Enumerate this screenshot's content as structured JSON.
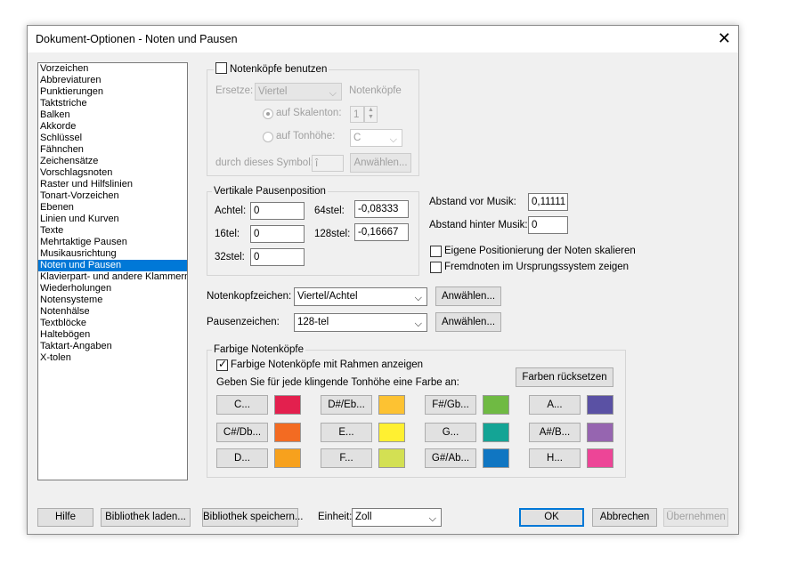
{
  "window": {
    "title": "Dokument-Optionen - Noten und Pausen"
  },
  "sidebar": {
    "items": [
      "Vorzeichen",
      "Abbreviaturen",
      "Punktierungen",
      "Taktstriche",
      "Balken",
      "Akkorde",
      "Schlüssel",
      "Fähnchen",
      "Zeichensätze",
      "Vorschlagsnoten",
      "Raster und Hilfslinien",
      "Tonart-Vorzeichen",
      "Ebenen",
      "Linien und Kurven",
      "Texte",
      "Mehrtaktige Pausen",
      "Musikausrichtung",
      "Noten und Pausen",
      "Klavierpart- und andere Klammern",
      "Wiederholungen",
      "Notensysteme",
      "Notenhälse",
      "Textblöcke",
      "Haltebögen",
      "Taktart-Angaben",
      "X-tolen"
    ],
    "selected": "Noten und Pausen"
  },
  "noteheads": {
    "checkbox_label": "Notenköpfe benutzen",
    "replace_label": "Ersetze:",
    "replace_value": "Viertel",
    "noteheads_label": "Notenköpfe",
    "on_scale_label": "auf Skalenton:",
    "scale_value": "1",
    "on_pitch_label": "auf Tonhöhe:",
    "pitch_value": "C",
    "symbol_label": "durch dieses Symbol:",
    "symbol_value": "î",
    "select_label": "Anwählen..."
  },
  "rest_position": {
    "legend": "Vertikale Pausenposition",
    "fields": [
      {
        "label": "Achtel:",
        "value": "0"
      },
      {
        "label": "16tel:",
        "value": "0"
      },
      {
        "label": "32stel:",
        "value": "0"
      },
      {
        "label": "64stel:",
        "value": "-0,08333"
      },
      {
        "label": "128stel:",
        "value": "-0,16667"
      }
    ]
  },
  "spacing": {
    "before_label": "Abstand vor Musik:",
    "before_value": "0,11111",
    "after_label": "Abstand hinter Musik:",
    "after_value": "0",
    "scale_label": "Eigene Positionierung der Noten skalieren",
    "cue_label": "Fremdnoten im Ursprungssystem zeigen"
  },
  "characters": {
    "notehead_label": "Notenkopfzeichen:",
    "notehead_value": "Viertel/Achtel",
    "rest_label": "Pausenzeichen:",
    "rest_value": "128-tel",
    "select_label": "Anwählen..."
  },
  "colored": {
    "legend": "Farbige Notenköpfe",
    "frame_label": "Farbige Notenköpfe mit Rahmen anzeigen",
    "reset_label": "Farben rücksetzen",
    "instruction": "Geben Sie für jede klingende Tonhöhe eine Farbe an:",
    "pitches": [
      {
        "label": "C...",
        "color": "#e3204e"
      },
      {
        "label": "C#/Db...",
        "color": "#f36b22"
      },
      {
        "label": "D...",
        "color": "#f7a11d"
      },
      {
        "label": "D#/Eb...",
        "color": "#fdc232"
      },
      {
        "label": "E...",
        "color": "#fff031"
      },
      {
        "label": "F...",
        "color": "#d3e053"
      },
      {
        "label": "F#/Gb...",
        "color": "#6fba43"
      },
      {
        "label": "G...",
        "color": "#14a495"
      },
      {
        "label": "G#/Ab...",
        "color": "#1076c2"
      },
      {
        "label": "A...",
        "color": "#5a51a4"
      },
      {
        "label": "A#/B...",
        "color": "#9665b0"
      },
      {
        "label": "H...",
        "color": "#ed4597"
      }
    ]
  },
  "footer": {
    "help": "Hilfe",
    "load": "Bibliothek laden...",
    "save": "Bibliothek speichern...",
    "unit_label": "Einheit:",
    "unit_value": "Zoll",
    "ok": "OK",
    "cancel": "Abbrechen",
    "apply": "Übernehmen"
  }
}
